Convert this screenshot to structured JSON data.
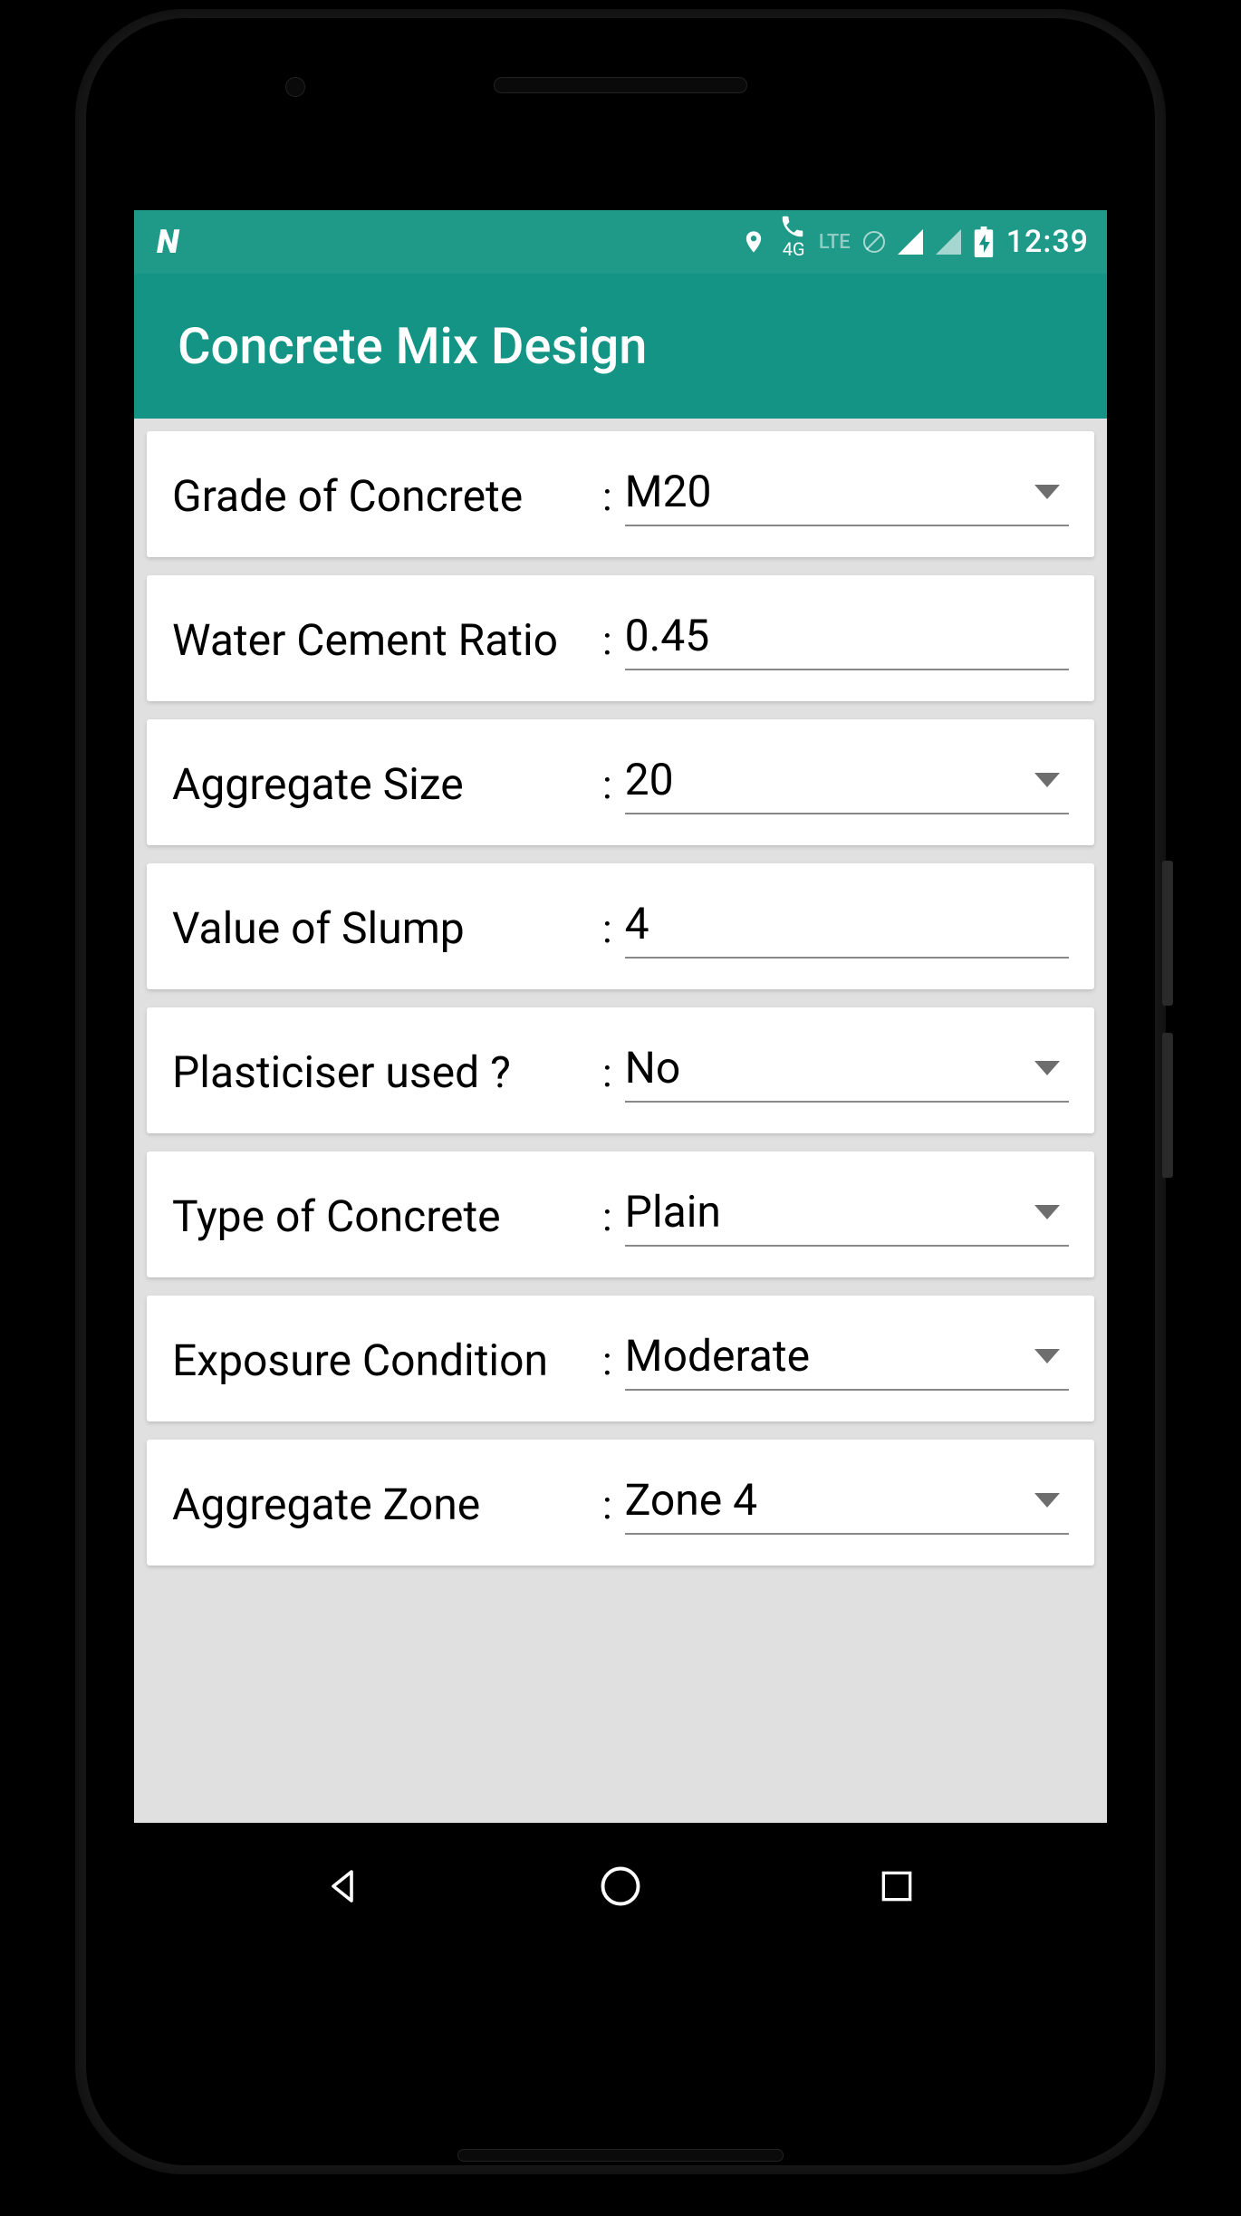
{
  "status_bar": {
    "time": "12:39",
    "network_label_4g": "4G",
    "network_label_lte": "LTE"
  },
  "app_bar": {
    "title": "Concrete Mix Design"
  },
  "form": {
    "rows": [
      {
        "label": "Grade of Concrete",
        "value": "M20",
        "kind": "select"
      },
      {
        "label": "Water Cement Ratio",
        "value": "0.45",
        "kind": "text"
      },
      {
        "label": "Aggregate Size",
        "value": "20",
        "kind": "select"
      },
      {
        "label": "Value of Slump",
        "value": "4",
        "kind": "text"
      },
      {
        "label": "Plasticiser used ?",
        "value": "No",
        "kind": "select"
      },
      {
        "label": "Type of Concrete",
        "value": "Plain",
        "kind": "select"
      },
      {
        "label": "Exposure Condition",
        "value": "Moderate",
        "kind": "select"
      },
      {
        "label": "Aggregate Zone",
        "value": "Zone 4",
        "kind": "select"
      }
    ]
  }
}
